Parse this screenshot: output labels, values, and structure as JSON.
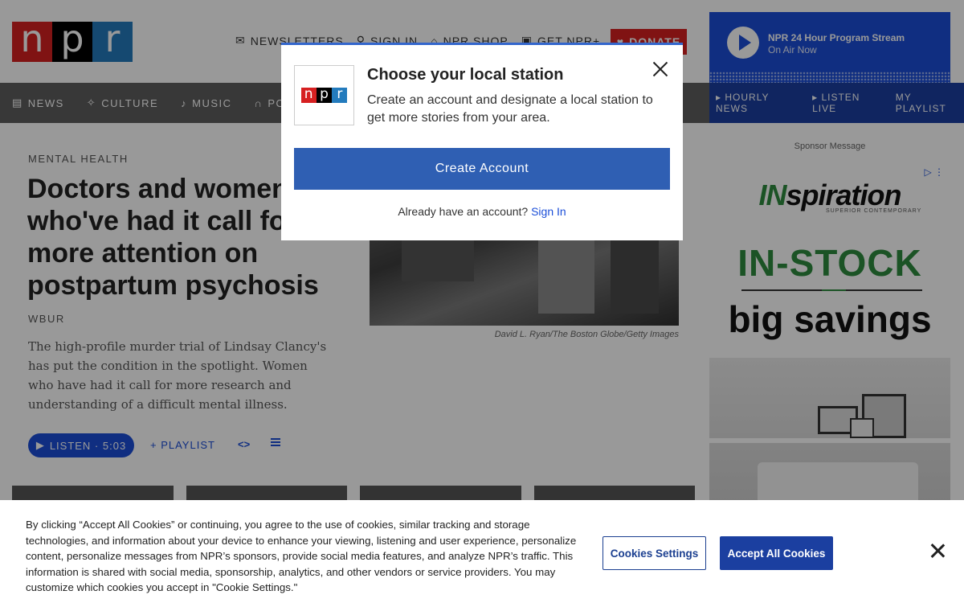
{
  "header": {
    "logo_letters": [
      "n",
      "p",
      "r"
    ],
    "util_links": [
      {
        "icon": "mail-icon",
        "label": "NEWSLETTERS"
      },
      {
        "icon": "user-icon",
        "label": "SIGN IN"
      },
      {
        "icon": "bag-icon",
        "label": "NPR SHOP"
      },
      {
        "icon": "app-icon",
        "label": "GET NPR+"
      }
    ],
    "donate_label": "DONATE"
  },
  "player": {
    "title": "NPR 24 Hour Program Stream",
    "subtitle": "On Air Now"
  },
  "nav": {
    "items": [
      {
        "icon": "news-icon",
        "label": "NEWS"
      },
      {
        "icon": "culture-icon",
        "label": "CULTURE"
      },
      {
        "icon": "music-icon",
        "label": "MUSIC"
      },
      {
        "icon": "headphones-icon",
        "label": "PO"
      }
    ],
    "right_items": [
      "▸ HOURLY NEWS",
      "▸ LISTEN LIVE",
      "MY PLAYLIST"
    ]
  },
  "article": {
    "kicker": "MENTAL HEALTH",
    "headline": "Doctors and women who've had it call for more attention on postpartum psychosis",
    "source": "WBUR",
    "teaser": "The high-profile murder trial of Lindsay Clancy's has put the condition in the spotlight. Women who have had it call for more research and understanding of a difficult mental illness.",
    "listen_label": "LISTEN · 5:03",
    "playlist_label": "+ PLAYLIST",
    "embed_label": "<>",
    "photo_credit": "David L. Ryan/The Boston Globe/Getty Images"
  },
  "ad": {
    "sponsor_label": "Sponsor Message",
    "brand_part1": "IN",
    "brand_part2": "spiration",
    "brand_sub": "SUPERIOR CONTEMPORARY",
    "headline1": "IN-STOCK",
    "headline2": "big savings",
    "adchoices_icon": "▷ ⋮"
  },
  "modal": {
    "logo_letters": [
      "n",
      "p",
      "r"
    ],
    "title": "Choose your local station",
    "description": "Create an account and designate a local station to get more stories from your area.",
    "create_label": "Create Account",
    "already_text": "Already have an account?",
    "signin_label": "Sign In"
  },
  "cookie": {
    "text": "By clicking “Accept All Cookies” or continuing, you agree to the use of cookies, similar tracking and storage technologies, and information about your device to enhance your viewing, listening and user experience, personalize content, personalize messages from NPR’s sponsors, provide social media features, and analyze NPR’s traffic. This information is shared with social media, sponsorship, analytics, and other vendors or service providers. You may customize which cookies you accept in \"Cookie Settings.\"",
    "settings_label": "Cookies Settings",
    "accept_label": "Accept All Cookies"
  },
  "colors": {
    "npr_red": "#d62021",
    "npr_black": "#000000",
    "npr_blue": "#237bbd",
    "accent_blue": "#1b4ed8",
    "cookie_blue": "#1b3fa0"
  }
}
